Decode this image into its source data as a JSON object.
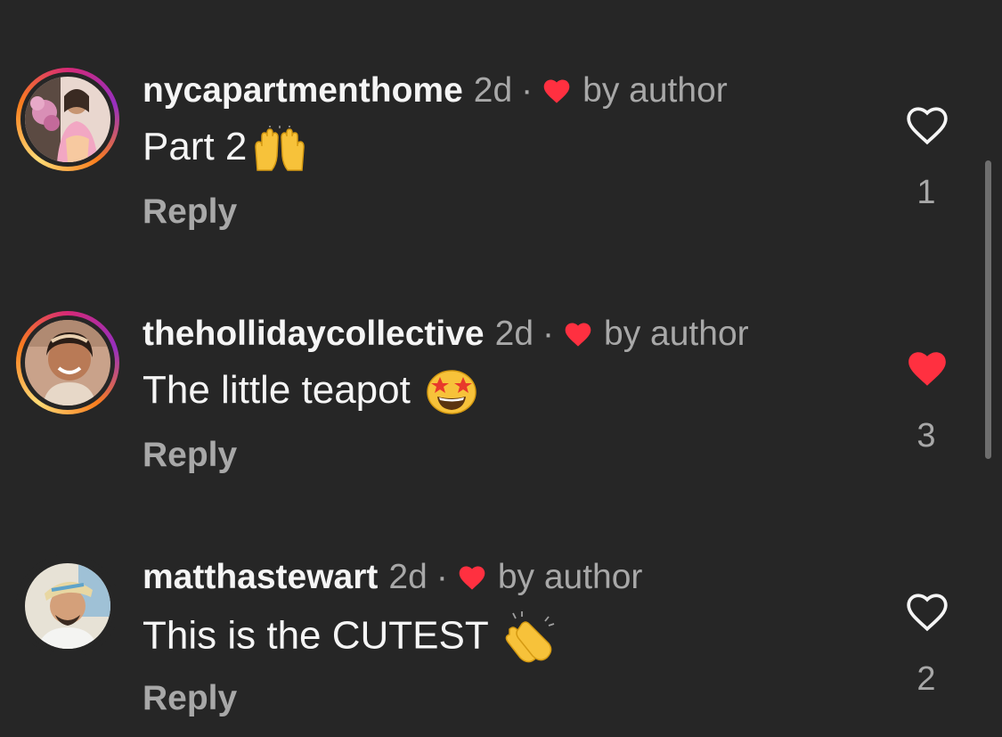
{
  "comments": [
    {
      "username": "nycapartmenthome",
      "time": "2d",
      "separator": "·",
      "author_label": "by author",
      "text": "Part 2",
      "emoji": "raising-hands",
      "reply_label": "Reply",
      "liked": false,
      "like_count": "1",
      "has_story_ring": true
    },
    {
      "username": "thehollidaycollective",
      "time": "2d",
      "separator": "·",
      "author_label": "by author",
      "text": "The little teapot ",
      "emoji": "star-struck",
      "reply_label": "Reply",
      "liked": true,
      "like_count": "3",
      "has_story_ring": true
    },
    {
      "username": "matthastewart",
      "time": "2d",
      "separator": "·",
      "author_label": "by author",
      "text": "This is the CUTEST ",
      "emoji": "clapping-hands",
      "reply_label": "Reply",
      "liked": false,
      "like_count": "2",
      "has_story_ring": false
    }
  ],
  "colors": {
    "background": "#262626",
    "primary_text": "#f5f5f5",
    "secondary_text": "#a8a8a8",
    "heart_red": "#ff3040"
  }
}
